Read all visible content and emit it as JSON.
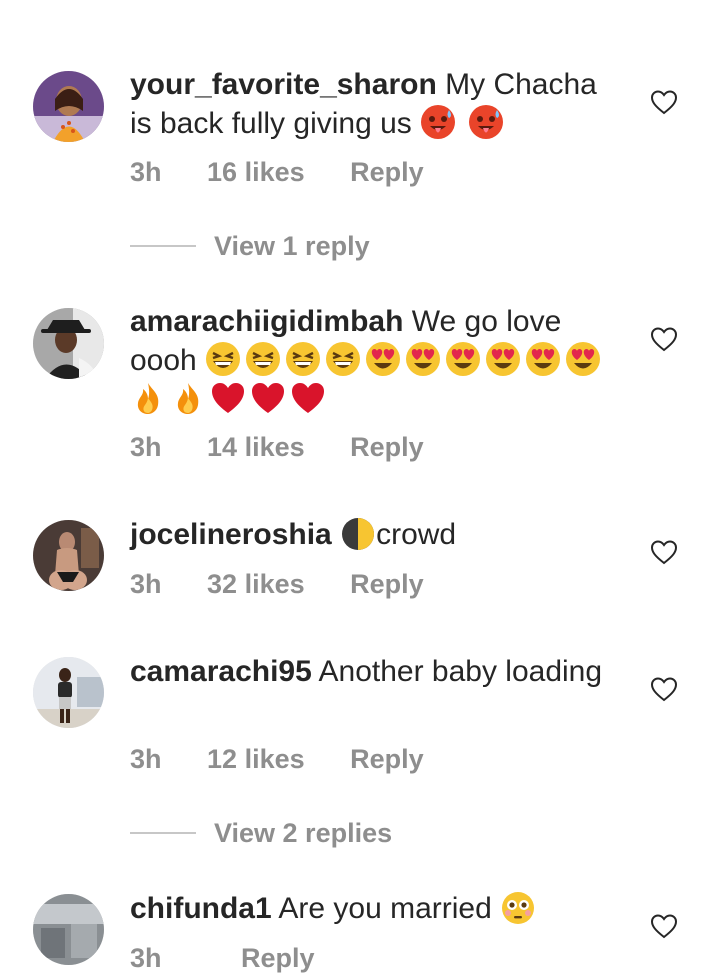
{
  "comments": [
    {
      "username": "your_favorite_sharon",
      "text": "My Chacha is back fully giving us",
      "emojis": [
        "hot-face",
        "hot-face"
      ],
      "time": "3h",
      "likes": "16 likes",
      "reply_label": "Reply",
      "view_replies": "View 1 reply"
    },
    {
      "username": "amarachiigidimbah",
      "text": "We go love oooh",
      "emojis": [
        "grinning-squinting",
        "grinning-squinting",
        "grinning-squinting",
        "grinning-squinting",
        "heart-eyes",
        "heart-eyes",
        "heart-eyes",
        "heart-eyes",
        "heart-eyes",
        "heart-eyes",
        "fire",
        "fire",
        "red-heart",
        "red-heart",
        "red-heart"
      ],
      "time": "3h",
      "likes": "14 likes",
      "reply_label": "Reply"
    },
    {
      "username": "jocelineroshia",
      "emojis": [
        "last-quarter-moon"
      ],
      "text_after": "crowd",
      "time": "3h",
      "likes": "32 likes",
      "reply_label": "Reply"
    },
    {
      "username": "camarachi95",
      "text": "Another baby loading",
      "time": "3h",
      "likes": "12 likes",
      "reply_label": "Reply",
      "view_replies": "View 2 replies"
    },
    {
      "username": "chifunda1",
      "text": "Are you married",
      "emojis": [
        "flushed-face"
      ],
      "time": "3h",
      "reply_label": "Reply"
    }
  ],
  "colors": {
    "text": "#262626",
    "meta": "#8e8e8e",
    "divider": "#c7c7c7"
  }
}
